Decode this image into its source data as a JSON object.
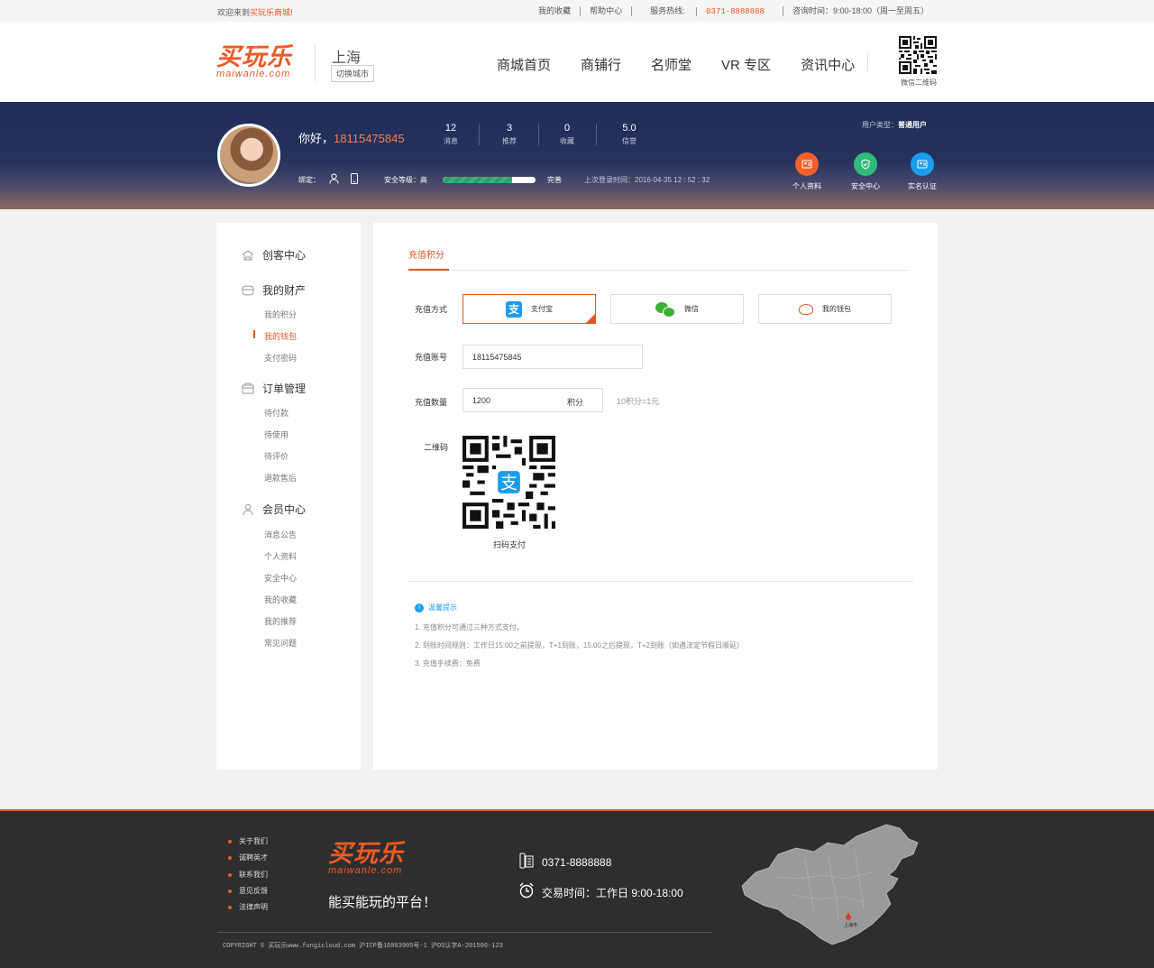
{
  "topbar": {
    "welcome_prefix": "欢迎来到",
    "welcome_brand": "买玩乐商城",
    "welcome_suffix": "!",
    "favorites": "我的收藏",
    "help": "帮助中心",
    "hotline_label": "服务热线:",
    "hotline": "0371-8888888",
    "hours": "咨询时间：9:00-18:00（周一至周五）"
  },
  "header": {
    "logo_cn": "买玩乐",
    "logo_en": "maiwanle.com",
    "city": "上海",
    "switch_city": "切换城市",
    "nav": [
      "商城首页",
      "商铺行",
      "名师堂",
      "VR 专区",
      "资讯中心"
    ],
    "qr_label": "微信二维码"
  },
  "profile": {
    "greeting": "你好，",
    "phone": "18115475845",
    "stats": [
      {
        "value": "12",
        "label": "消息"
      },
      {
        "value": "3",
        "label": "推荐"
      },
      {
        "value": "0",
        "label": "收藏"
      },
      {
        "value": "5.0",
        "label": "信誉"
      }
    ],
    "bind_label": "绑定：",
    "security_label": "安全等级：高",
    "security_level": 0.75,
    "security_status": "完善",
    "last_login": "上次登录时间：2016-04-35 12 : 52 : 32",
    "user_type_label": "用户类型：",
    "user_type": "普通用户",
    "quick_links": [
      {
        "label": "个人资料",
        "color": "#f0612c",
        "icon": "profile-icon"
      },
      {
        "label": "安全中心",
        "color": "#2dbb7a",
        "icon": "shield-icon"
      },
      {
        "label": "实名认证",
        "color": "#1a9dec",
        "icon": "id-card-icon"
      }
    ]
  },
  "sidebar": {
    "sections": [
      {
        "title": "创客中心",
        "icon": "maker-icon",
        "items": []
      },
      {
        "title": "我的财产",
        "icon": "wallet-icon",
        "items": [
          "我的积分",
          "我的钱包",
          "支付密码"
        ]
      },
      {
        "title": "订单管理",
        "icon": "order-icon",
        "items": [
          "待付款",
          "待使用",
          "待评价",
          "退款售后"
        ]
      },
      {
        "title": "会员中心",
        "icon": "user-icon",
        "items": [
          "消息公告",
          "个人资料",
          "安全中心",
          "我的收藏",
          "我的推荐",
          "常见问题"
        ]
      }
    ],
    "active_item": "我的钱包"
  },
  "main": {
    "tab": "充值积分",
    "method_label": "充值方式",
    "methods": [
      "支付宝",
      "微信",
      "我的钱包"
    ],
    "account_label": "充值账号",
    "account_value": "18115475845",
    "amount_label": "充值数量",
    "amount_value": "1200",
    "amount_unit": "积分",
    "rate": "10积分=1元",
    "qr_label": "二维码",
    "scan_label": "扫码支付",
    "tips_title": "温馨提示",
    "tips": [
      "1. 充值积分可通过三种方式支付。",
      "2. 到账时间规则：工作日15:00之前提现，T+1到账，15:00之后提现，T+2到账（如遇法定节假日顺延）",
      "3. 充值手续费：免费"
    ]
  },
  "footer": {
    "links": [
      "关于我们",
      "诚聘英才",
      "联系我们",
      "意见反馈",
      "法律声明"
    ],
    "logo_cn": "买玩乐",
    "logo_en": "maiwanle.com",
    "slogan": "能买能玩的平台！",
    "phone": "0371-8888888",
    "hours": "交易时间：工作日 9:00-18:00",
    "copyright": "COPYRIGHT ©  买玩乐www.fungicloud.com  沪ICP备16003905号-1 沪DS认字A-201506-123",
    "map_marker": "上海市"
  },
  "colors": {
    "accent": "#e8541e",
    "banner": "#1f2d57",
    "footer": "#2e2e2e",
    "alipay": "#1a9dec",
    "wechat": "#3cb034"
  }
}
